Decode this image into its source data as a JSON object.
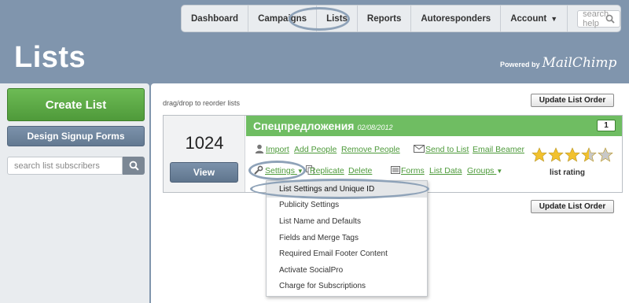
{
  "nav": {
    "items": [
      "Dashboard",
      "Campaigns",
      "Lists",
      "Reports",
      "Autoresponders",
      "Account"
    ],
    "account_caret": "▼",
    "search_placeholder": "search help"
  },
  "page": {
    "title": "Lists",
    "powered_by": "Powered by",
    "brand": "MailChimp"
  },
  "sidebar": {
    "create_list": "Create List",
    "design_signup_forms": "Design Signup Forms",
    "search_placeholder": "search list subscribers"
  },
  "content": {
    "reorder_hint": "drag/drop to reorder lists",
    "update_order_label": "Update List Order"
  },
  "list_card": {
    "subscriber_count": "1024",
    "view_label": "View",
    "name": "Спецпредложения",
    "date": "02/08/2012",
    "badge": "1",
    "actions": {
      "import": "Import",
      "add_people": "Add People",
      "remove_people": "Remove People",
      "send_to_list": "Send to List",
      "email_beamer": "Email Beamer",
      "settings": "Settings",
      "settings_caret": "▼",
      "replicate": "Replicate",
      "delete": "Delete",
      "forms": "Forms",
      "list_data": "List Data",
      "groups": "Groups",
      "groups_caret": "▼"
    },
    "rating": 3.5,
    "rating_max": 5,
    "rating_label": "list rating"
  },
  "settings_menu": {
    "items": [
      "List Settings and Unique ID",
      "Publicity Settings",
      "List Name and Defaults",
      "Fields and Merge Tags",
      "Required Email Footer Content",
      "Activate SocialPro",
      "Charge for Subscriptions"
    ],
    "highlighted_index": 0
  },
  "colors": {
    "header_bg": "#8095ad",
    "green": "#6fbd62",
    "link_green": "#4d9a3a",
    "blue_button": "#6f859e",
    "star": "#f2c12e"
  }
}
